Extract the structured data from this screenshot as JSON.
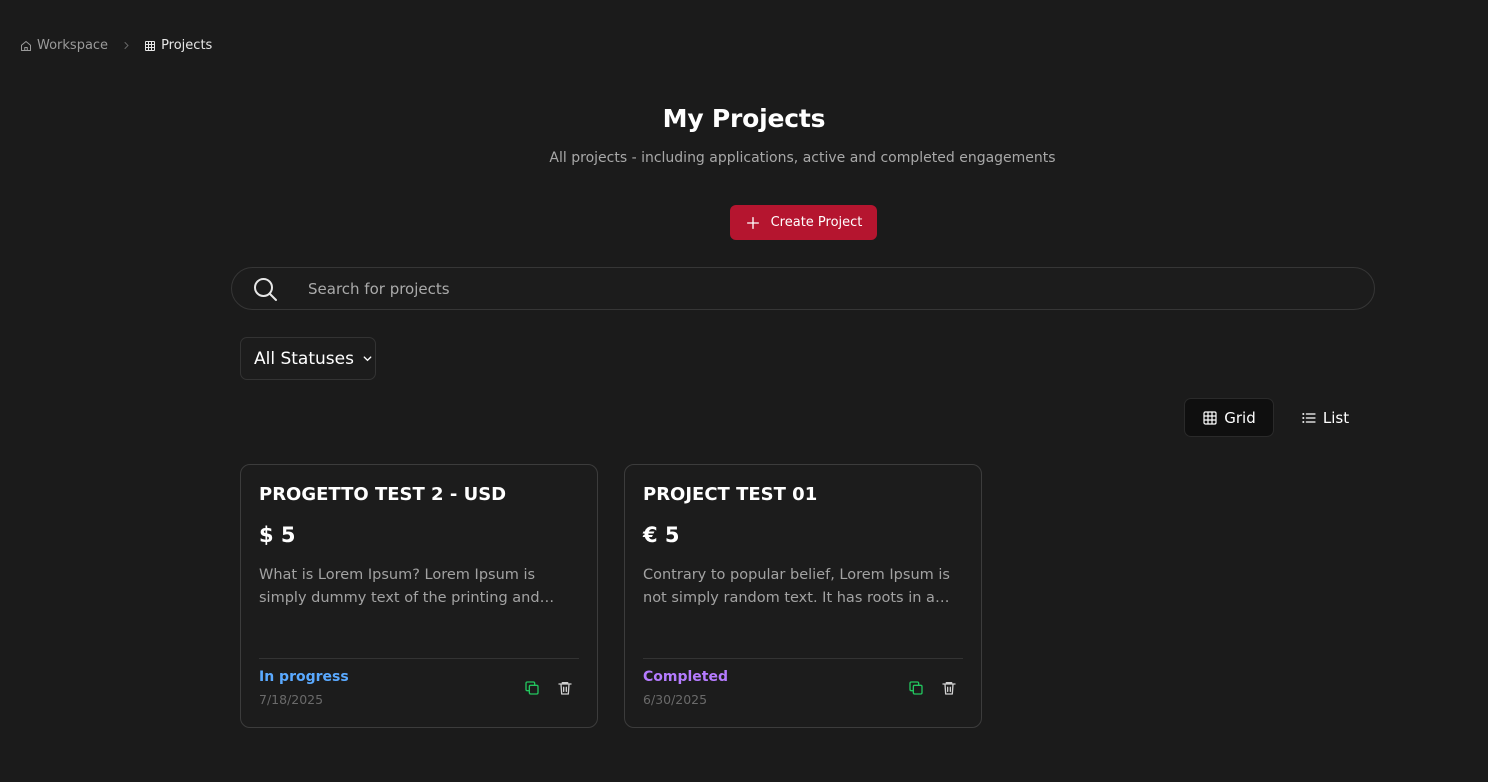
{
  "breadcrumb": {
    "items": [
      {
        "label": "Workspace",
        "icon": "home-icon"
      },
      {
        "label": "Projects",
        "icon": "grid-icon"
      }
    ]
  },
  "header": {
    "title": "My Projects",
    "subtitle": "All projects - including applications, active and completed engagements"
  },
  "actions": {
    "create_label": "Create Project"
  },
  "search": {
    "placeholder": "Search for projects",
    "value": ""
  },
  "filter": {
    "status_selected": "All Statuses"
  },
  "view_toggle": {
    "grid_label": "Grid",
    "list_label": "List",
    "active": "Grid"
  },
  "projects": [
    {
      "title": "PROGETTO TEST 2 - USD",
      "price": "$ 5",
      "description": "What is Lorem Ipsum? Lorem Ipsum is simply dummy text of the printing and typesetting industry.",
      "status": "In progress",
      "status_color": "#5aa9ff",
      "date": "7/18/2025"
    },
    {
      "title": "PROJECT TEST 01",
      "price": "€ 5",
      "description": "Contrary to popular belief, Lorem Ipsum is not simply random text. It has roots in a piece of classical Latin literature.",
      "status": "Completed",
      "status_color": "#b57bff",
      "date": "6/30/2025"
    }
  ],
  "colors": {
    "background": "#1b1b1b",
    "accent": "#b5152f",
    "copy_icon": "#22c55e"
  }
}
